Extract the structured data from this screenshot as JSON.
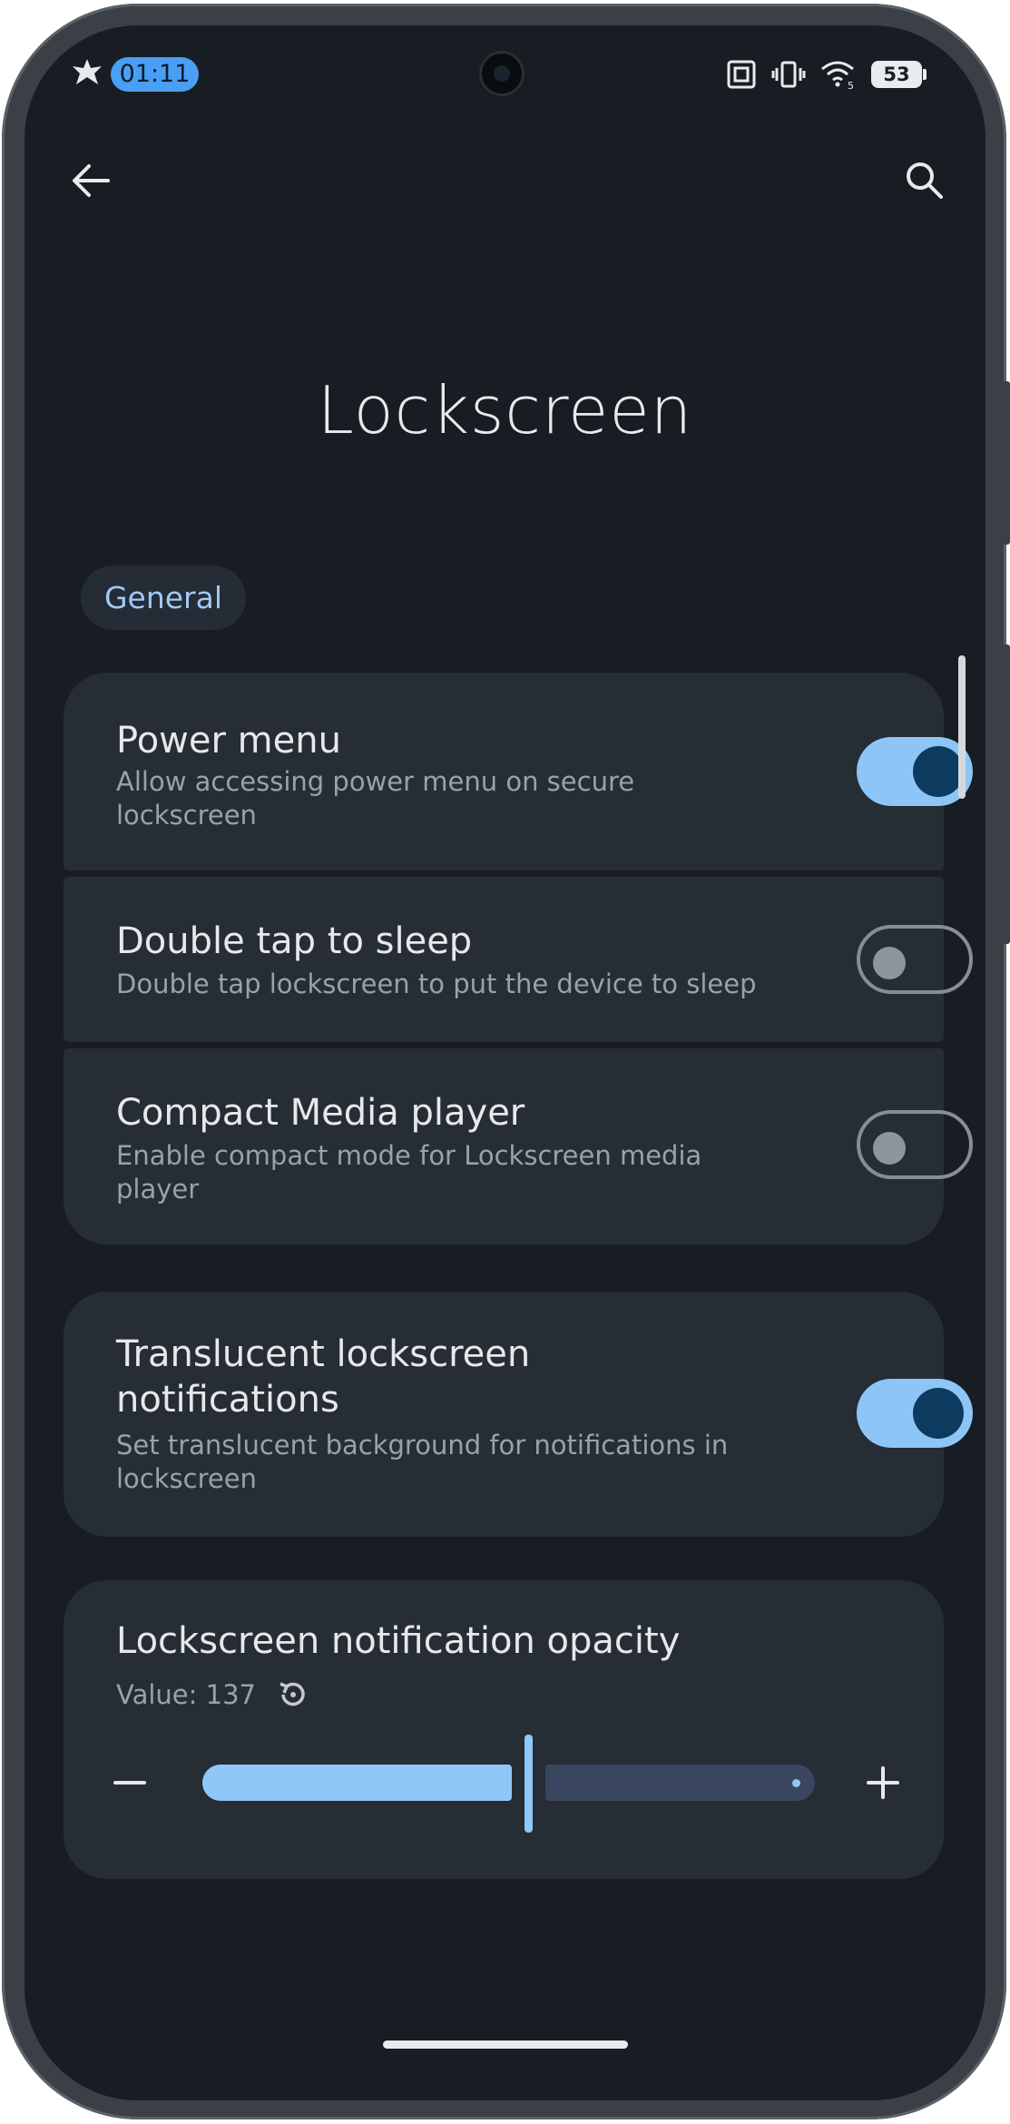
{
  "status_bar": {
    "time": "01:11",
    "battery": "53",
    "icons": [
      "app-logo-icon",
      "nfc-icon",
      "vibrate-icon",
      "wifi-icon",
      "battery-icon"
    ]
  },
  "toolbar": {
    "back_icon": "back-arrow-icon",
    "search_icon": "search-icon"
  },
  "page": {
    "title": "Lockscreen",
    "section_chip": "General"
  },
  "settings": [
    {
      "label": "Power menu",
      "description": "Allow accessing power menu on secure lockscreen",
      "enabled": true
    },
    {
      "label": "Double tap to sleep",
      "description": "Double tap lockscreen to put the device to sleep",
      "enabled": false
    },
    {
      "label": "Compact Media player",
      "description": "Enable compact mode for Lockscreen media player",
      "enabled": false
    },
    {
      "label": "Translucent lockscreen notifications",
      "description": "Set translucent background for notifications in lockscreen",
      "enabled": true
    }
  ],
  "opacity_setting": {
    "label": "Lockscreen notification opacity",
    "value_text": "Value: 137",
    "value": 137,
    "minus_icon": "minus-icon",
    "plus_icon": "plus-icon",
    "reset_icon": "reset-icon"
  },
  "colors": {
    "background": "#171d23",
    "card": "#262d35",
    "accent": "#8dc6f6",
    "chip_text": "#9ec9f7",
    "status_time_bg": "#4a9ff5"
  }
}
